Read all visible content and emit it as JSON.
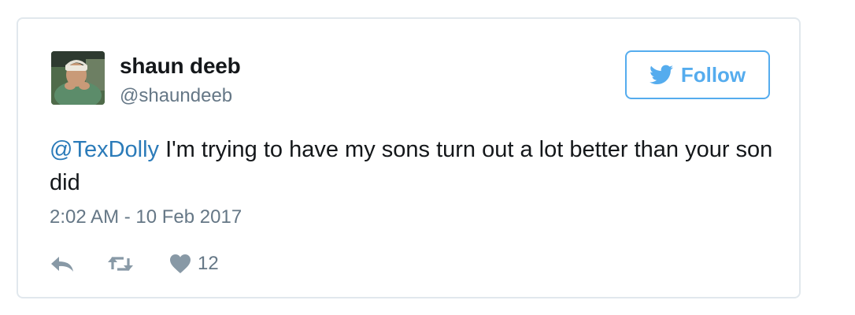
{
  "author": {
    "name": "shaun deeb",
    "handle": "@shaundeeb"
  },
  "follow_button": {
    "label": "Follow",
    "icon": "twitter-bird-icon"
  },
  "tweet": {
    "mention": "@TexDolly",
    "text": " I'm trying to have my sons turn out a lot better than your son did",
    "timestamp": "2:02 AM - 10 Feb 2017"
  },
  "actions": {
    "reply_icon": "reply-icon",
    "retweet_icon": "retweet-icon",
    "like_icon": "heart-icon",
    "like_count": "12"
  },
  "colors": {
    "accent": "#55acee",
    "link": "#2b7bb9",
    "secondary_text": "#657786",
    "action_icon": "#8899a6",
    "border": "#e1e8ed"
  }
}
